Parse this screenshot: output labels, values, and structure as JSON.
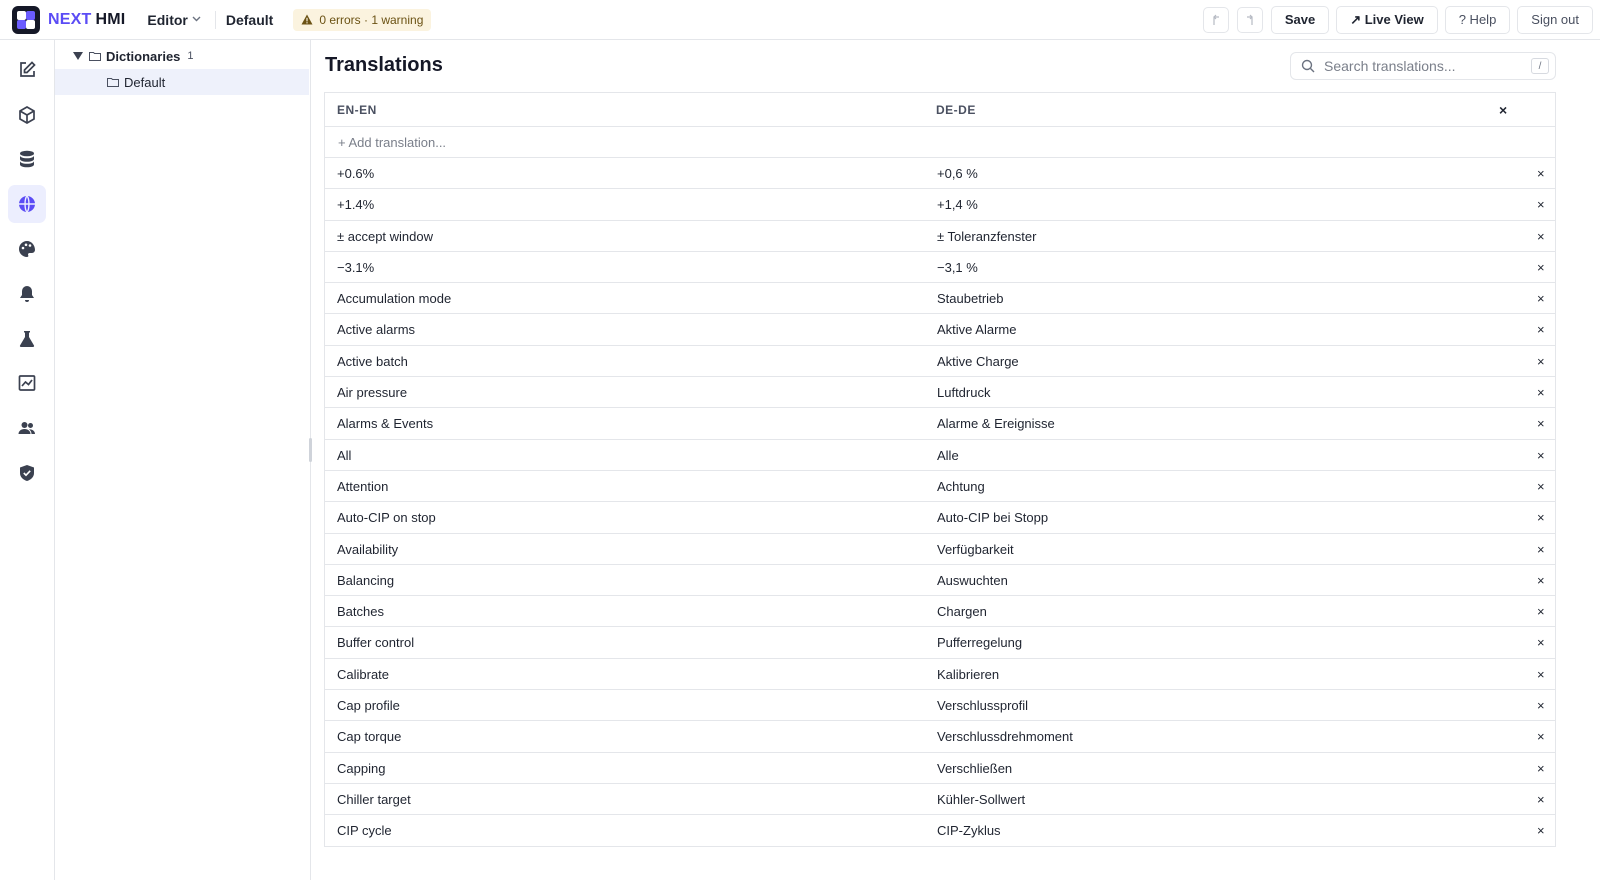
{
  "header": {
    "brand_next": "NEXT",
    "brand_hmi": "HMI",
    "mode": "Editor",
    "project": "Default",
    "status": "0 errors · 1 warning",
    "save": "Save",
    "live_view": "↗ Live View",
    "help": "? Help",
    "sign_out": "Sign out"
  },
  "rail": {
    "items": [
      "edit-icon",
      "cube-icon",
      "database-icon",
      "globe-icon",
      "palette-icon",
      "bell-icon",
      "flask-icon",
      "chart-icon",
      "users-icon",
      "shield-icon"
    ],
    "active": "globe-icon"
  },
  "tree": {
    "root_label": "Dictionaries",
    "root_count": "1",
    "child_label": "Default"
  },
  "main": {
    "title": "Translations",
    "search_placeholder": "Search translations...",
    "search_shortcut": "/",
    "col_en": "EN-EN",
    "col_de": "DE-DE",
    "col_close": "×",
    "add_placeholder": "+ Add translation...",
    "delete_glyph": "×",
    "rows": [
      {
        "en": "+0.6%",
        "de": "+0,6 %"
      },
      {
        "en": "+1.4%",
        "de": "+1,4 %"
      },
      {
        "en": "± accept window",
        "de": "± Toleranzfenster"
      },
      {
        "en": "−3.1%",
        "de": "−3,1 %"
      },
      {
        "en": "Accumulation mode",
        "de": "Staubetrieb"
      },
      {
        "en": "Active alarms",
        "de": "Aktive Alarme"
      },
      {
        "en": "Active batch",
        "de": "Aktive Charge"
      },
      {
        "en": "Air pressure",
        "de": "Luftdruck"
      },
      {
        "en": "Alarms & Events",
        "de": "Alarme & Ereignisse"
      },
      {
        "en": "All",
        "de": "Alle"
      },
      {
        "en": "Attention",
        "de": "Achtung"
      },
      {
        "en": "Auto-CIP on stop",
        "de": "Auto-CIP bei Stopp"
      },
      {
        "en": "Availability",
        "de": "Verfügbarkeit"
      },
      {
        "en": "Balancing",
        "de": "Auswuchten"
      },
      {
        "en": "Batches",
        "de": "Chargen"
      },
      {
        "en": "Buffer control",
        "de": "Pufferregelung"
      },
      {
        "en": "Calibrate",
        "de": "Kalibrieren"
      },
      {
        "en": "Cap profile",
        "de": "Verschlussprofil"
      },
      {
        "en": "Cap torque",
        "de": "Verschlussdrehmoment"
      },
      {
        "en": "Capping",
        "de": "Verschließen"
      },
      {
        "en": "Chiller target",
        "de": "Kühler-Sollwert"
      },
      {
        "en": "CIP cycle",
        "de": "CIP-Zyklus"
      }
    ]
  },
  "colors": {
    "accent": "#5b4cf5",
    "active_bg": "#eceefe",
    "warning_bg": "#fbf3df",
    "border": "#e4e6ea"
  }
}
